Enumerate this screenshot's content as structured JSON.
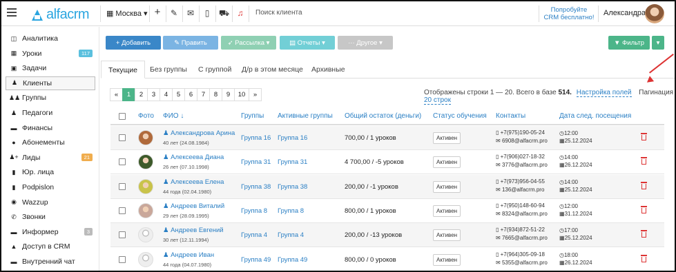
{
  "topbar": {
    "logo_text": "alfacrm",
    "city": "Москва",
    "search_placeholder": "Поиск клиента",
    "promo_line1": "Попробуйте",
    "promo_line2": "CRM бесплатно!",
    "user_name": "Александра"
  },
  "sidebar": {
    "items": [
      {
        "label": "Аналитика",
        "icon": "chart-icon"
      },
      {
        "label": "Уроки",
        "icon": "calendar-icon",
        "badge": "117",
        "badge_color": "#5bc0de"
      },
      {
        "label": "Задачи",
        "icon": "clipboard-icon"
      },
      {
        "label": "Клиенты",
        "icon": "user-icon",
        "active": true
      },
      {
        "label": "Группы",
        "icon": "users-icon"
      },
      {
        "label": "Педагоги",
        "icon": "teacher-icon"
      },
      {
        "label": "Финансы",
        "icon": "money-icon"
      },
      {
        "label": "Абонементы",
        "icon": "ticket-icon"
      },
      {
        "label": "Лиды",
        "icon": "user-plus-icon",
        "badge": "21",
        "badge_color": "#f0ad4e"
      },
      {
        "label": "Юр. лица",
        "icon": "building-icon"
      },
      {
        "label": "Podpislon",
        "icon": "document-icon"
      },
      {
        "label": "Wazzup",
        "icon": "whatsapp-icon"
      },
      {
        "label": "Звонки",
        "icon": "phone-icon"
      },
      {
        "label": "Информер",
        "icon": "info-icon",
        "badge": "3",
        "badge_color": "#bbbbbb"
      },
      {
        "label": "Доступ в CRM",
        "icon": "lock-icon"
      },
      {
        "label": "Внутренний чат",
        "icon": "chat-icon"
      }
    ]
  },
  "toolbar": {
    "add": "+ Добавить",
    "edit": "✎ Править",
    "mailing": "➶ Рассылка ▾",
    "reports": "▤ Отчеты ▾",
    "other": "··· Другое ▾",
    "filter": "▼ Фильтр"
  },
  "tabs": [
    "Текущие",
    "Без группы",
    "С группой",
    "Д/р в этом месяце",
    "Архивные"
  ],
  "pagination": {
    "pages": [
      "«",
      "1",
      "2",
      "3",
      "4",
      "5",
      "6",
      "7",
      "8",
      "9",
      "10",
      "»"
    ],
    "active": "1",
    "info_prefix": "Отображены строки 1 — 20. Всего в базе ",
    "total": "514.",
    "settings_link": "Настройка полей",
    "page_size_label": "Пагинация",
    "page_size_link": "20 строк"
  },
  "table": {
    "headers": {
      "photo": "Фото",
      "fio": "ФИО ↓",
      "groups": "Группы",
      "active_groups": "Активные группы",
      "balance": "Общий остаток (деньги)",
      "status": "Статус обучения",
      "contacts": "Контакты",
      "next_visit": "Дата след. посещения"
    },
    "rows": [
      {
        "name": "Александрова Арина",
        "age": "40 лет (24.08.1984)",
        "group": "Группа 16",
        "active_group": "Группа 16",
        "balance": "700,00 / 1 уроков",
        "status": "Активен",
        "phone": "+7(975)190-05-24",
        "email": "6908@alfacrm.pro",
        "time": "12:00",
        "date": "25.12.2024",
        "photo": "#b06a3b"
      },
      {
        "name": "Алексеева Диана",
        "age": "26 лет (07.10.1998)",
        "group": "Группа 31",
        "active_group": "Группа 31",
        "balance": "4 700,00 / -5 уроков",
        "status": "Активен",
        "phone": "+7(906)027-18-32",
        "email": "3776@alfacrm.pro",
        "time": "14:00",
        "date": "26.12.2024",
        "photo": "#3d5a2a"
      },
      {
        "name": "Алексеева Елена",
        "age": "44 года (02.04.1980)",
        "group": "Группа 38",
        "active_group": "Группа 38",
        "balance": "200,00 / -1 уроков",
        "status": "Активен",
        "phone": "+7(973)956-04-55",
        "email": "136@alfacrm.pro",
        "time": "14:00",
        "date": "25.12.2024",
        "photo": "#c9c34a"
      },
      {
        "name": "Андреев Виталий",
        "age": "29 лет (28.09.1995)",
        "group": "Группа 8",
        "active_group": "Группа 8",
        "balance": "800,00 / 1 уроков",
        "status": "Активен",
        "phone": "+7(950)148-60-94",
        "email": "8324@alfacrm.pro",
        "time": "12:00",
        "date": "31.12.2024",
        "photo": "#c9a79a"
      },
      {
        "name": "Андреев Евгений",
        "age": "30 лет (12.11.1994)",
        "group": "Группа 4",
        "active_group": "Группа 4",
        "balance": "200,00 / -13 уроков",
        "status": "Активен",
        "phone": "+7(934)872-51-22",
        "email": "7665@alfacrm.pro",
        "time": "17:00",
        "date": "25.12.2024",
        "photo": "#e6e6e6"
      },
      {
        "name": "Андреев Иван",
        "age": "44 года (04.07.1980)",
        "group": "Группа 49",
        "active_group": "Группа 49",
        "balance": "800,00 / 0 уроков",
        "status": "Активен",
        "phone": "+7(964)305-09-18",
        "email": "5355@alfacrm.pro",
        "time": "18:00",
        "date": "26.12.2024",
        "photo": "#e6e6e6"
      }
    ]
  }
}
